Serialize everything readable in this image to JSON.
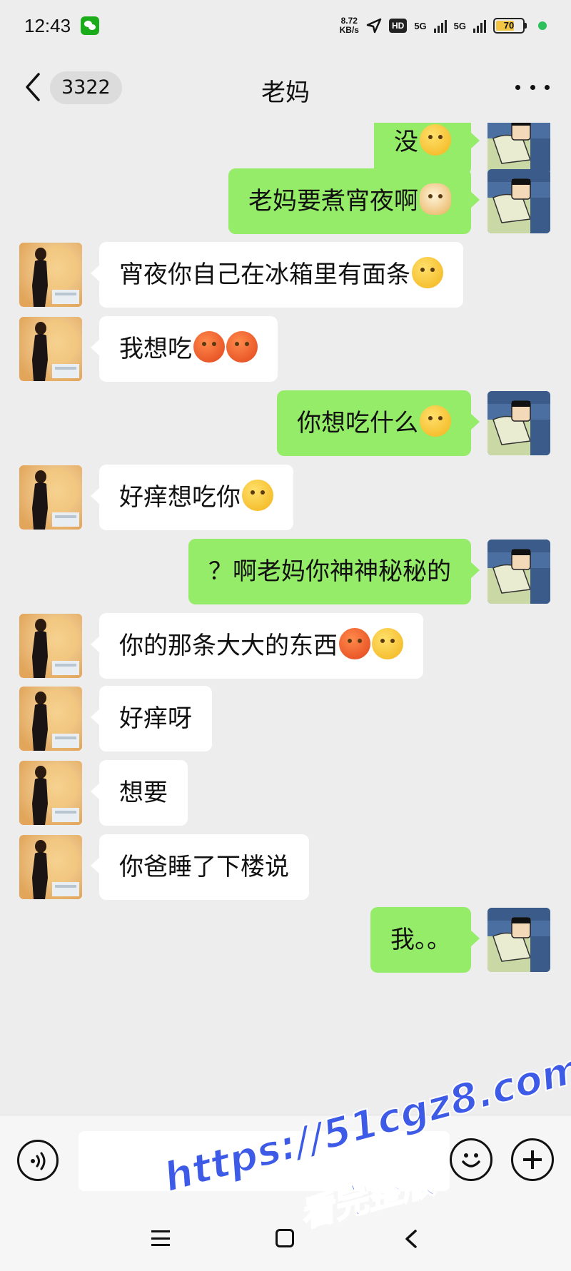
{
  "status_bar": {
    "time": "12:43",
    "net_speed_value": "8.72",
    "net_speed_unit": "KB/s",
    "hd_label": "HD",
    "sim1_label": "5G",
    "sim2_label": "5G",
    "battery_level": "70",
    "battery_fill_fraction": 0.7
  },
  "header": {
    "unread_count": "3322",
    "title": "老妈"
  },
  "messages": [
    {
      "sender": "self",
      "text": "没",
      "emoji": [
        "yellow"
      ]
    },
    {
      "sender": "self",
      "text": "老妈要煮宵夜啊",
      "emoji": [
        "dog"
      ]
    },
    {
      "sender": "other",
      "text": "宵夜你自己在冰箱里有面条",
      "emoji": [
        "yellow"
      ]
    },
    {
      "sender": "other",
      "text": "我想吃",
      "emoji": [
        "red",
        "red"
      ]
    },
    {
      "sender": "self",
      "text": "你想吃什么",
      "emoji": [
        "yellow"
      ]
    },
    {
      "sender": "other",
      "text": "好痒想吃你",
      "emoji": [
        "yellow"
      ]
    },
    {
      "sender": "self",
      "text": "？啊老妈你神神秘秘的",
      "emoji": []
    },
    {
      "sender": "other",
      "text": "你的那条大大的东西",
      "emoji": [
        "red",
        "yellow"
      ]
    },
    {
      "sender": "other",
      "text": "好痒呀",
      "emoji": []
    },
    {
      "sender": "other",
      "text": "想要",
      "emoji": []
    },
    {
      "sender": "other",
      "text": "你爸睡了下楼说",
      "emoji": []
    },
    {
      "sender": "self",
      "text": "我。。",
      "emoji": []
    }
  ],
  "input_bar": {
    "text_value": ""
  },
  "watermark": {
    "url": "https://51cgz8.com",
    "caption": "看完整版"
  }
}
